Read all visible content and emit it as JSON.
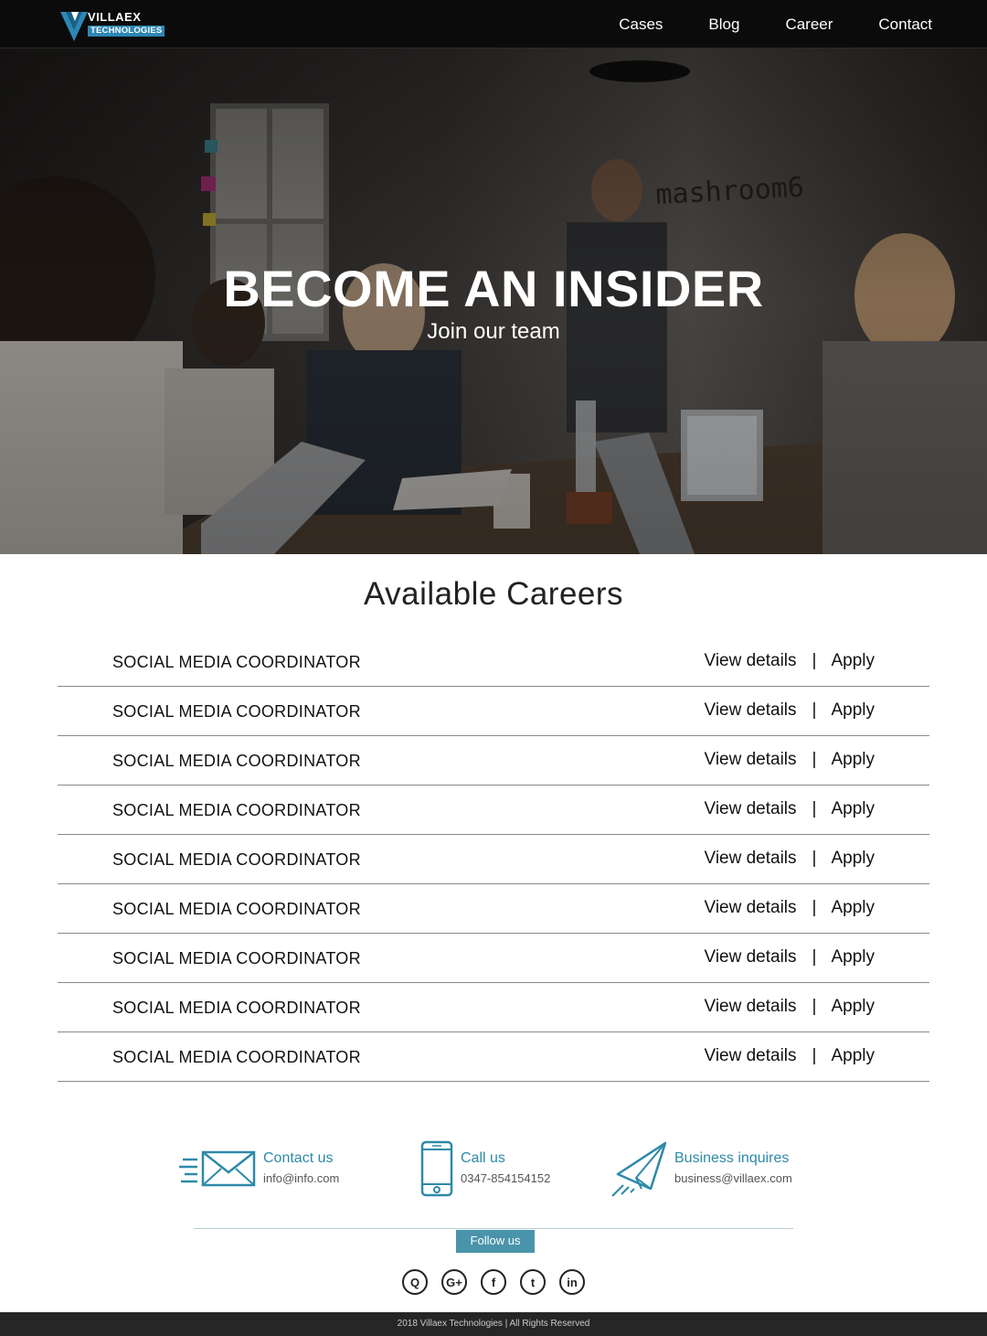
{
  "brand": {
    "line1": "VILLAEX",
    "line2": "TECHNOLOGIES",
    "accent": "#2d87b4"
  },
  "nav": {
    "items": [
      "Cases",
      "Blog",
      "Career",
      "Contact"
    ]
  },
  "hero": {
    "title": "BECOME AN INSIDER",
    "subtitle": "Join our team",
    "wall_sign": "mashroom6"
  },
  "careers": {
    "title": "Available Careers",
    "jobs": [
      {
        "title": "SOCIAL MEDIA COORDINATOR",
        "details": "View details",
        "sep": "|",
        "apply": "Apply"
      },
      {
        "title": "SOCIAL MEDIA COORDINATOR",
        "details": "View details",
        "sep": "|",
        "apply": "Apply"
      },
      {
        "title": "SOCIAL MEDIA COORDINATOR",
        "details": "View details",
        "sep": "|",
        "apply": "Apply"
      },
      {
        "title": "SOCIAL MEDIA COORDINATOR",
        "details": "View details",
        "sep": "|",
        "apply": "Apply"
      },
      {
        "title": "SOCIAL MEDIA COORDINATOR",
        "details": "View details",
        "sep": "|",
        "apply": "Apply"
      },
      {
        "title": "SOCIAL MEDIA COORDINATOR",
        "details": "View details",
        "sep": "|",
        "apply": "Apply"
      },
      {
        "title": "SOCIAL MEDIA COORDINATOR",
        "details": "View details",
        "sep": "|",
        "apply": "Apply"
      },
      {
        "title": "SOCIAL MEDIA COORDINATOR",
        "details": "View details",
        "sep": "|",
        "apply": "Apply"
      },
      {
        "title": "SOCIAL MEDIA COORDINATOR",
        "details": "View details",
        "sep": "|",
        "apply": "Apply"
      }
    ]
  },
  "contact": {
    "items": [
      {
        "label": "Contact us",
        "value": "info@info.com",
        "icon": "envelope-icon"
      },
      {
        "label": "Call us",
        "value": "0347-854154152",
        "icon": "phone-icon"
      },
      {
        "label": "Business inquires",
        "value": "business@villaex.com",
        "icon": "paper-plane-icon"
      }
    ],
    "accent": "#2e8aa8"
  },
  "follow": {
    "label": "Follow us",
    "badge_color": "#4a94ab"
  },
  "socials": [
    {
      "icon": "quora-icon",
      "glyph": "Q"
    },
    {
      "icon": "google-plus-icon",
      "glyph": "G+"
    },
    {
      "icon": "facebook-icon",
      "glyph": "f"
    },
    {
      "icon": "twitter-icon",
      "glyph": "t"
    },
    {
      "icon": "linkedin-icon",
      "glyph": "in"
    }
  ],
  "footer": {
    "text": "2018 Villaex Technologies | All Rights Reserved"
  }
}
